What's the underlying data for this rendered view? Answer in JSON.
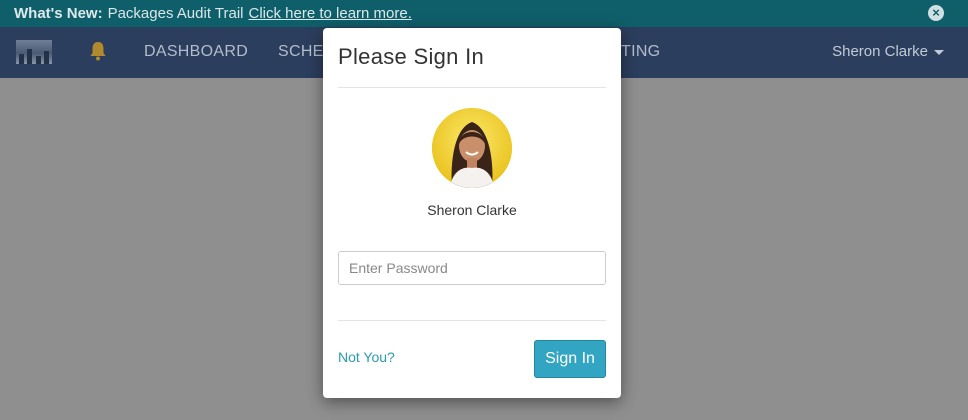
{
  "announcement": {
    "label": "What's New:",
    "text": "Packages Audit Trail",
    "link": "Click here to learn more."
  },
  "nav": {
    "links": [
      "DASHBOARD",
      "SCHE",
      "TING"
    ],
    "user": "Sheron Clarke"
  },
  "modal": {
    "title": "Please Sign In",
    "user_name": "Sheron Clarke",
    "password": {
      "placeholder": "Enter Password",
      "value": ""
    },
    "not_you": "Not You?",
    "signin": "Sign In"
  },
  "colors": {
    "announcement_bg": "#0f5f6a",
    "nav_bg": "#2c3e5e",
    "accent": "#31a5c1",
    "link": "#2a9bb4"
  }
}
